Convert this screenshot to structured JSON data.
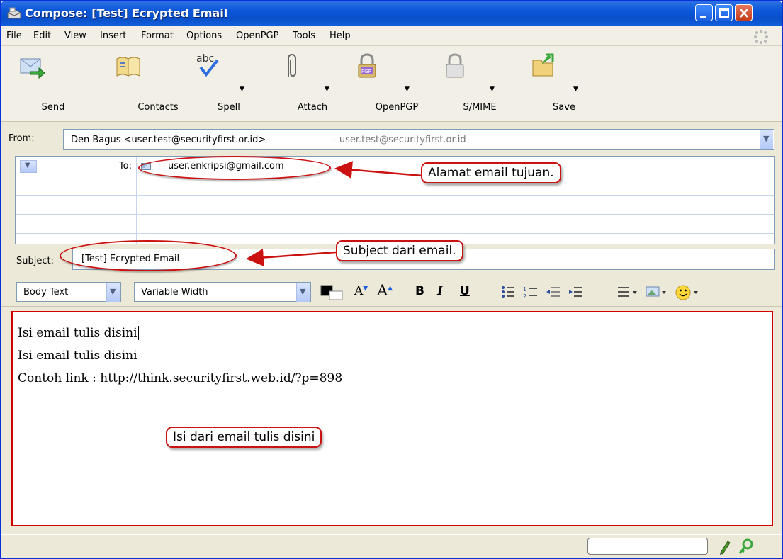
{
  "window": {
    "title": "Compose: [Test] Ecrypted Email"
  },
  "menu": [
    "File",
    "Edit",
    "View",
    "Insert",
    "Format",
    "Options",
    "OpenPGP",
    "Tools",
    "Help"
  ],
  "toolbar": {
    "send": "Send",
    "contacts": "Contacts",
    "spell": "Spell",
    "attach": "Attach",
    "openpgp": "OpenPGP",
    "smime": "S/MIME",
    "save": "Save"
  },
  "from": {
    "label": "From:",
    "value": "Den Bagus <user.test@securityfirst.or.id>",
    "alt": "- user.test@securityfirst.or.id"
  },
  "recipients": [
    {
      "type": "To:",
      "address": "user.enkripsi@gmail.com"
    }
  ],
  "subject": {
    "label": "Subject:",
    "value": "[Test] Ecrypted Email"
  },
  "format": {
    "paragraph_style": "Body Text",
    "font": "Variable Width"
  },
  "body": {
    "lines": [
      "Isi email tulis disini",
      "Isi email tulis disini",
      "Contoh link : http://think.securityfirst.web.id/?p=898"
    ]
  },
  "annotations": {
    "to_callout": "Alamat email tujuan.",
    "subject_callout": "Subject dari email.",
    "body_callout": "Isi dari email tulis disini"
  },
  "colors": {
    "titlebar": "#0a57d8",
    "annotation": "#cc1111"
  },
  "icons": [
    "mail-compose-icon",
    "send-icon",
    "contacts-icon",
    "spell-icon",
    "attach-icon",
    "openpgp-icon",
    "smime-icon",
    "save-icon",
    "throbber-icon",
    "pen-icon",
    "key-icon"
  ]
}
